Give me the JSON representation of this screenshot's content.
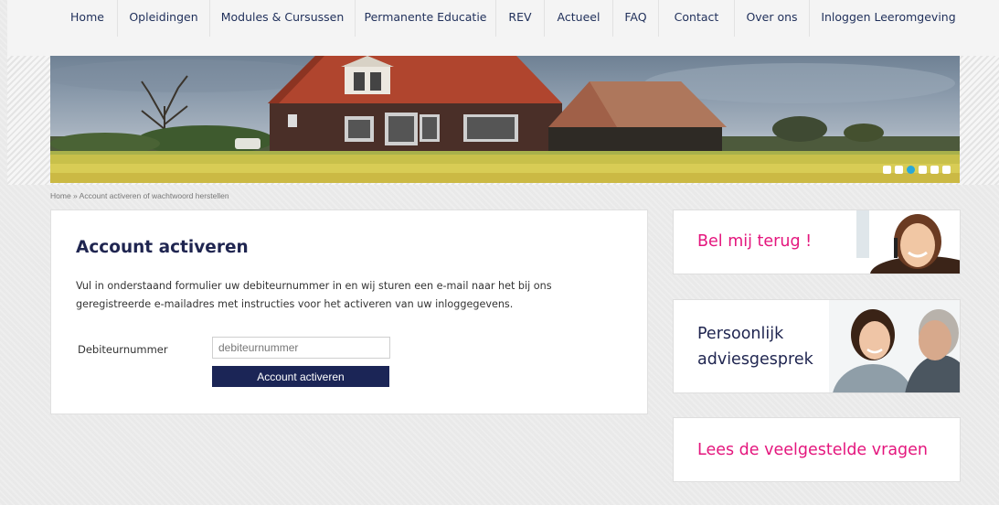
{
  "nav": {
    "items": [
      {
        "label": "Home"
      },
      {
        "label": "Opleidingen"
      },
      {
        "label": "Modules & Cursussen"
      },
      {
        "label": "Permanente Educatie"
      },
      {
        "label": "REV"
      },
      {
        "label": "Actueel"
      },
      {
        "label": "FAQ"
      },
      {
        "label": "Contact"
      },
      {
        "label": "Over ons"
      },
      {
        "label": "Inloggen Leeromgeving"
      }
    ]
  },
  "slider": {
    "slide_count": 6,
    "active_slide": 3
  },
  "breadcrumb": {
    "text": "Home » Account activeren of wachtwoord herstellen"
  },
  "main": {
    "title": "Account activeren",
    "description_line1": "Vul in onderstaand formulier uw debiteurnummer in en wij sturen een e-mail naar het bij ons",
    "description_line2": "geregistreerde e-mailadres met instructies voor het activeren van uw inloggegevens.",
    "form": {
      "label": "Debiteurnummer",
      "placeholder": "debiteurnummer",
      "value": "",
      "submit_label": "Account activeren"
    }
  },
  "sidebar": {
    "callback": {
      "label": "Bel mij terug !"
    },
    "advice": {
      "line1": "Persoonlijk",
      "line2": "adviesgesprek"
    },
    "faq": {
      "label": "Lees de veelgestelde vragen"
    }
  },
  "colors": {
    "brand_navy": "#1b2556",
    "accent_pink": "#e4167d",
    "slider_active": "#29a8d8"
  }
}
